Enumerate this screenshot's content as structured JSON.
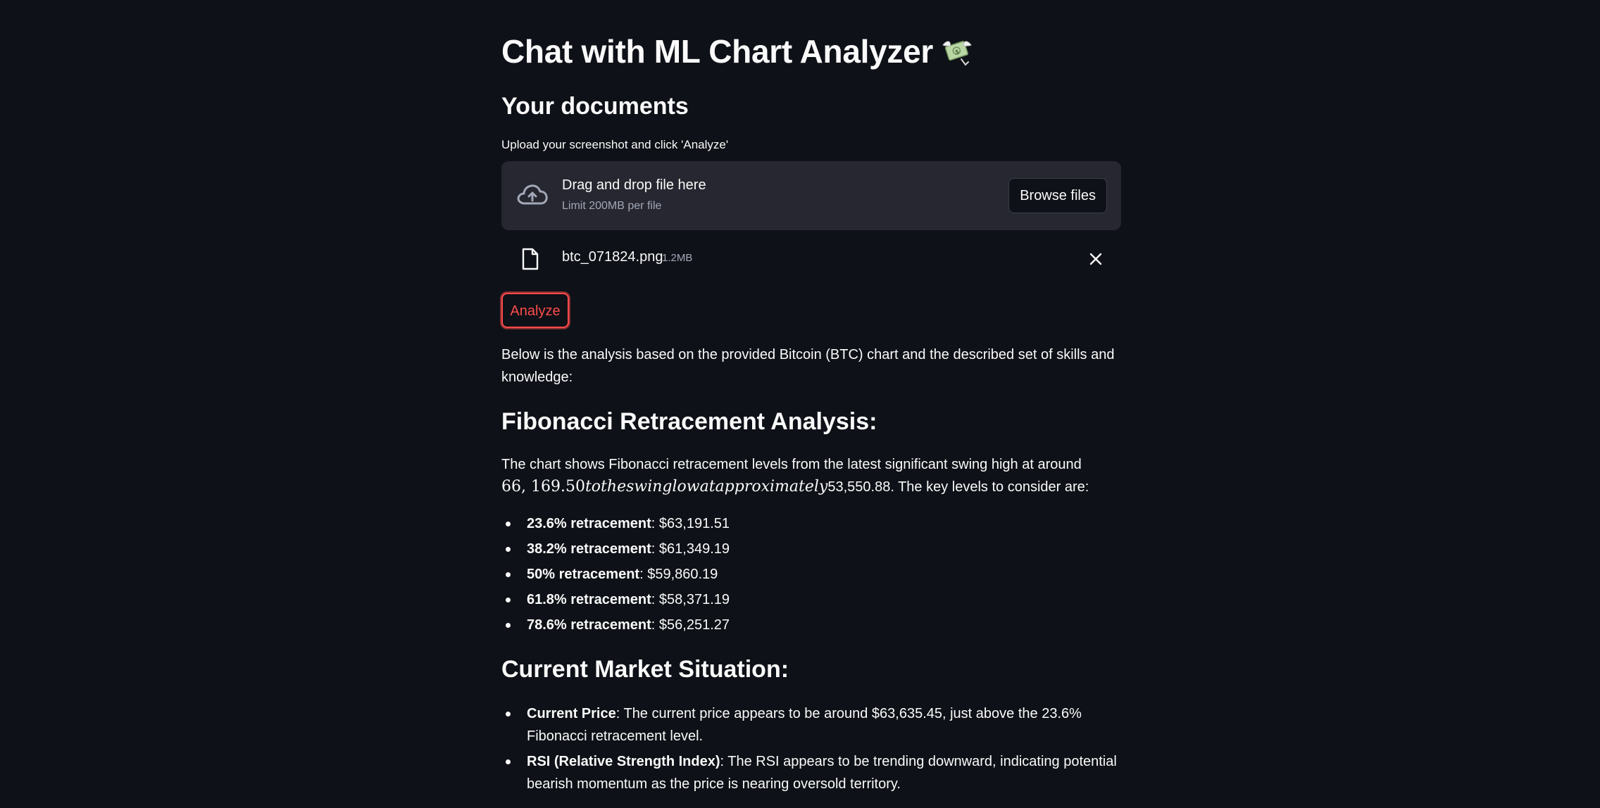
{
  "page": {
    "title": "Chat with ML Chart Analyzer",
    "title_emoji_icon": "money-with-wings-icon"
  },
  "documents": {
    "heading": "Your documents",
    "upload_label": "Upload your screenshot and click 'Analyze'",
    "dropzone_title": "Drag and drop file here",
    "dropzone_limit": "Limit 200MB per file",
    "browse_label": "Browse files",
    "file_name": "btc_071824.png",
    "file_size": "1.2MB"
  },
  "analyze_button": "Analyze",
  "analysis": {
    "intro": "Below is the analysis based on the provided Bitcoin (BTC) chart and the described set of skills and knowledge:",
    "fib_heading": "Fibonacci Retracement Analysis:",
    "fib_text_start": "The chart shows Fibonacci retracement levels from the latest significant swing high at around",
    "fib_math_num": "66, 169.50",
    "fib_math_text": "totheswinglowatapproximately",
    "fib_text_end": "53,550.88. The key levels to consider are:",
    "fib_levels": [
      {
        "label": "23.6% retracement",
        "value": ": $63,191.51"
      },
      {
        "label": "38.2% retracement",
        "value": ": $61,349.19"
      },
      {
        "label": "50% retracement",
        "value": ": $59,860.19"
      },
      {
        "label": "61.8% retracement",
        "value": ": $58,371.19"
      },
      {
        "label": "78.6% retracement",
        "value": ": $56,251.27"
      }
    ],
    "market_heading": "Current Market Situation:",
    "market_items": [
      {
        "label": "Current Price",
        "text": ": The current price appears to be around $63,635.45, just above the 23.6% Fibonacci retracement level."
      },
      {
        "label": "RSI (Relative Strength Index)",
        "text": ": The RSI appears to be trending downward, indicating potential bearish momentum as the price is nearing oversold territory."
      }
    ]
  },
  "colors": {
    "background": "#0e1117",
    "surface": "#262730",
    "accent": "#ff4b4b",
    "text": "#fafafa",
    "muted": "#a3a8b8"
  }
}
